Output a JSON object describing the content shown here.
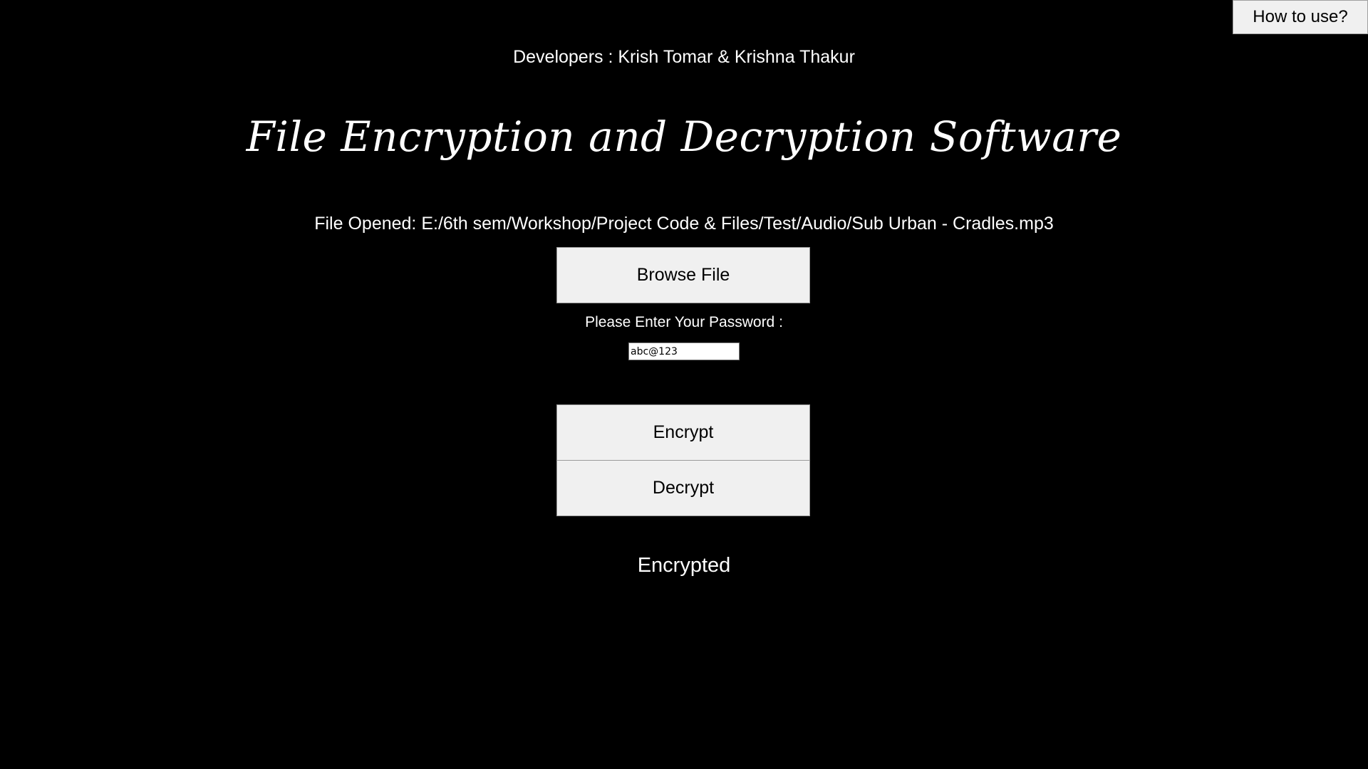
{
  "header": {
    "help_button_label": "How to use?",
    "developers": "Developers : Krish Tomar & Krishna Thakur",
    "title": "File Encryption and Decryption Software"
  },
  "file": {
    "opened_text": "File Opened: E:/6th sem/Workshop/Project Code & Files/Test/Audio/Sub Urban - Cradles.mp3",
    "browse_label": "Browse File"
  },
  "password": {
    "label": "Please Enter Your Password :",
    "value": "abc@123"
  },
  "actions": {
    "encrypt_label": "Encrypt",
    "decrypt_label": "Decrypt"
  },
  "status": {
    "text": "Encrypted"
  },
  "colors": {
    "background": "#000000",
    "text": "#ffffff",
    "button_bg": "#f0f0f0"
  }
}
